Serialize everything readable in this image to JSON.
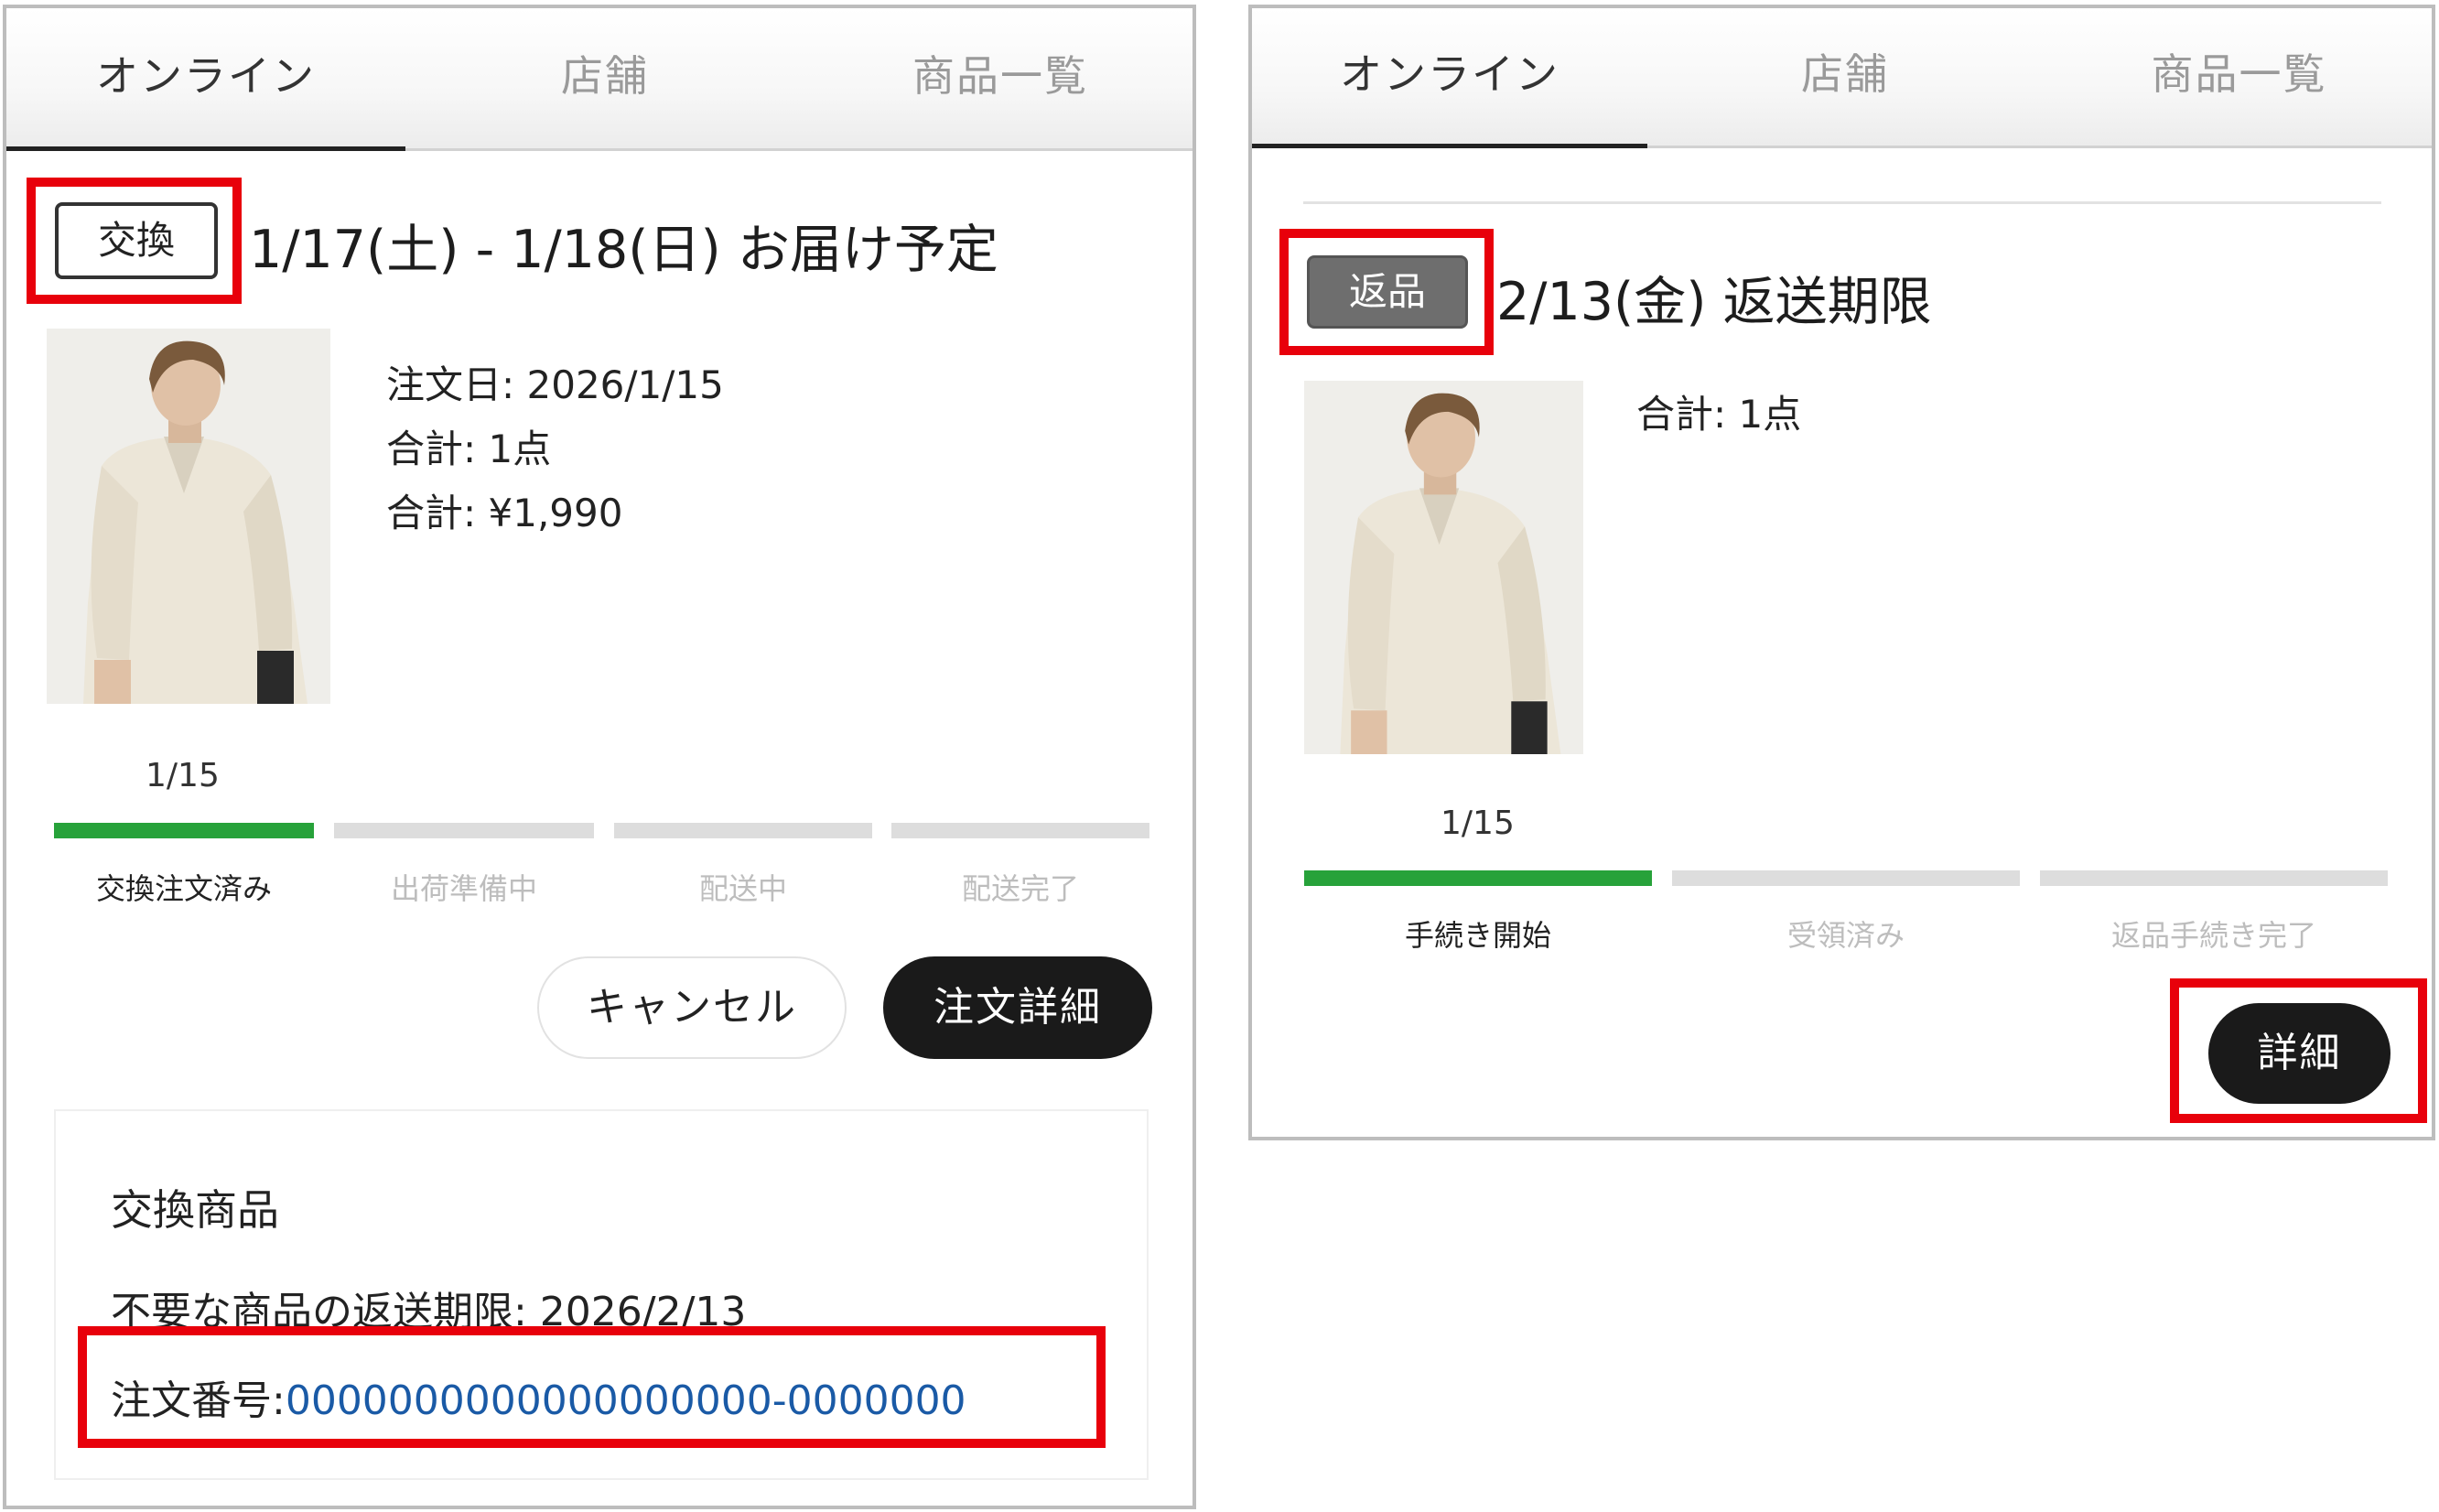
{
  "tabs": [
    "オンライン",
    "店舗",
    "商品一覧"
  ],
  "left": {
    "tag": "交換",
    "headline": "1/17(土) - 1/18(日) お届け予定",
    "order_date": "注文日: 2026/1/15",
    "total_qty": "合計: 1点",
    "total_price": "合計: ¥1,990",
    "photo_caption": "1/15",
    "steps": [
      {
        "label": "交換注文済み",
        "done": true
      },
      {
        "label": "出荷準備中",
        "done": false
      },
      {
        "label": "配送中",
        "done": false
      },
      {
        "label": "配送完了",
        "done": false
      }
    ],
    "cancel_label": "キャンセル",
    "detail_label": "注文詳細",
    "exchange": {
      "title": "交換商品",
      "deadline": "不要な商品の返送期限: 2026/2/13",
      "order_no_label": "注文番号:",
      "order_no": "0000000000000000000-0000000"
    }
  },
  "right": {
    "tag": "返品",
    "headline": "2/13(金) 返送期限",
    "total_qty": "合計: 1点",
    "photo_caption": "1/15",
    "steps": [
      {
        "label": "手続き開始",
        "done": true
      },
      {
        "label": "受領済み",
        "done": false
      },
      {
        "label": "返品手続き完了",
        "done": false
      }
    ],
    "detail_label": "詳細"
  },
  "colors": {
    "highlight": "#e8000b",
    "progress_done": "#27a23a",
    "progress_todo": "#dddddd",
    "link": "#1a5aa6",
    "dark_button": "#1a1a1a"
  }
}
